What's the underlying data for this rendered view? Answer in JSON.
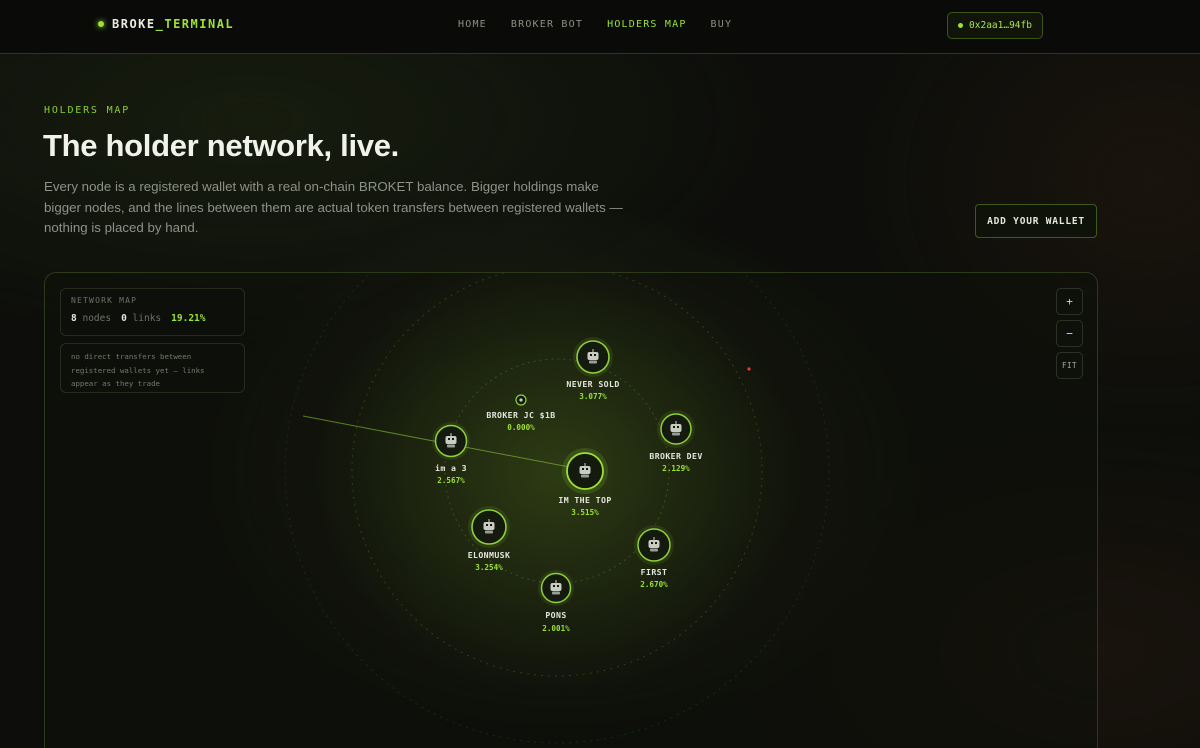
{
  "nav": {
    "brand_prefix": "BROKE",
    "brand_suffix": "_TERMINAL",
    "links": [
      "HOME",
      "BROKER BOT",
      "HOLDERS MAP",
      "BUY"
    ],
    "active_link": "HOLDERS MAP",
    "wallet_address": "0x2aa1…94fb"
  },
  "header": {
    "eyebrow": "HOLDERS MAP",
    "title": "The holder network, live.",
    "description": "Every node is a registered wallet with a real on-chain BROKET balance. Bigger holdings make bigger nodes, and the lines between them are actual token transfers between registered wallets — nothing is placed by hand.",
    "add_wallet_label": "ADD YOUR WALLET"
  },
  "map": {
    "stats_label": "NETWORK MAP",
    "nodes_count": "8",
    "nodes_unit": "nodes",
    "links_count": "0",
    "links_unit": "links",
    "total_pct": "19.21%",
    "note": "no direct transfers between registered wallets yet — links appear as they trade",
    "zoom_in_label": "+",
    "zoom_out_label": "−",
    "fit_label": "FIT",
    "nodes": [
      {
        "name": "NEVER SOLD",
        "pct": "3.077%"
      },
      {
        "name": "BROKER JC $1B",
        "pct": "0.000%"
      },
      {
        "name": "BROKER DEV",
        "pct": "2.129%"
      },
      {
        "name": "im a 3",
        "pct": "2.567%"
      },
      {
        "name": "IM THE TOP",
        "pct": "3.515%"
      },
      {
        "name": "ELONMUSK",
        "pct": "3.254%"
      },
      {
        "name": "FIRST",
        "pct": "2.670%"
      },
      {
        "name": "PONS",
        "pct": "2.001%"
      }
    ],
    "colors": {
      "accent": "#9be235",
      "node_ring": "#8fcf3a",
      "stray_dot": "#e03a3a"
    }
  }
}
